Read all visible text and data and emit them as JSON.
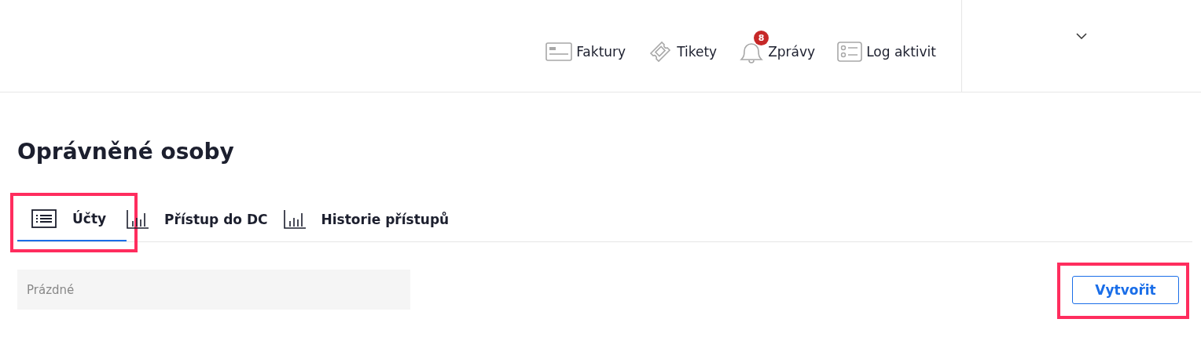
{
  "header": {
    "nav": [
      {
        "kind": "invoice",
        "label": "Faktury"
      },
      {
        "kind": "ticket",
        "label": "Tikety"
      },
      {
        "kind": "bell",
        "label": "Zprávy",
        "badge": "8"
      },
      {
        "kind": "log",
        "label": "Log aktivit"
      }
    ]
  },
  "page": {
    "title": "Oprávněné osoby",
    "tabs": [
      {
        "kind": "list",
        "label": "Účty",
        "selected": true,
        "highlighted": true
      },
      {
        "kind": "chart",
        "label": "Přístup do DC",
        "selected": false,
        "highlighted": false
      },
      {
        "kind": "chart",
        "label": "Historie přístupů",
        "selected": false,
        "highlighted": false
      }
    ],
    "filter": {
      "placeholder": "Prázdné"
    },
    "create_button": {
      "label": "Vytvořit",
      "highlighted": true
    }
  }
}
